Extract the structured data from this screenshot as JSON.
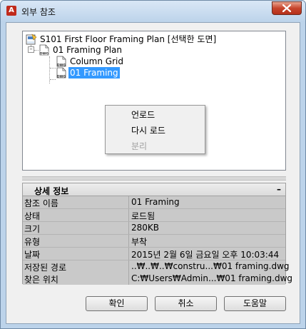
{
  "window": {
    "title": "외부 참조",
    "app_icon_letter": "A"
  },
  "tree": {
    "root": {
      "label": "S101 First Floor Framing Plan [선택한 도면]"
    },
    "nodes": [
      {
        "label": "01 Framing Plan",
        "expanded": true
      },
      {
        "label": "Column Grid"
      },
      {
        "label": "01 Framing",
        "selected": true
      }
    ],
    "icon_caption": "DWG"
  },
  "context_menu": {
    "items": [
      {
        "label": "언로드",
        "enabled": true
      },
      {
        "label": "다시 로드",
        "enabled": true
      },
      {
        "label": "분리",
        "enabled": false
      }
    ]
  },
  "details": {
    "title": "상세 정보",
    "collapse_symbol": "–",
    "rows": [
      {
        "key": "참조 이름",
        "value": "01 Framing"
      },
      {
        "key": "상태",
        "value": "로드됨"
      },
      {
        "key": "크기",
        "value": "280KB"
      },
      {
        "key": "유형",
        "value": "부착"
      },
      {
        "key": "날짜",
        "value": "2015년 2월 6일 금요일  오후 10:03:44"
      },
      {
        "key": "저장된 경로",
        "value": "..₩..₩..₩constru...₩01 framing.dwg"
      },
      {
        "key": "찾은 위치",
        "value": "C:₩Users₩Admin...₩01 framing.dwg"
      }
    ]
  },
  "buttons": {
    "ok": "확인",
    "cancel": "취소",
    "help": "도움말"
  },
  "colors": {
    "selection": "#3399ff",
    "close_button": "#c7452d"
  }
}
